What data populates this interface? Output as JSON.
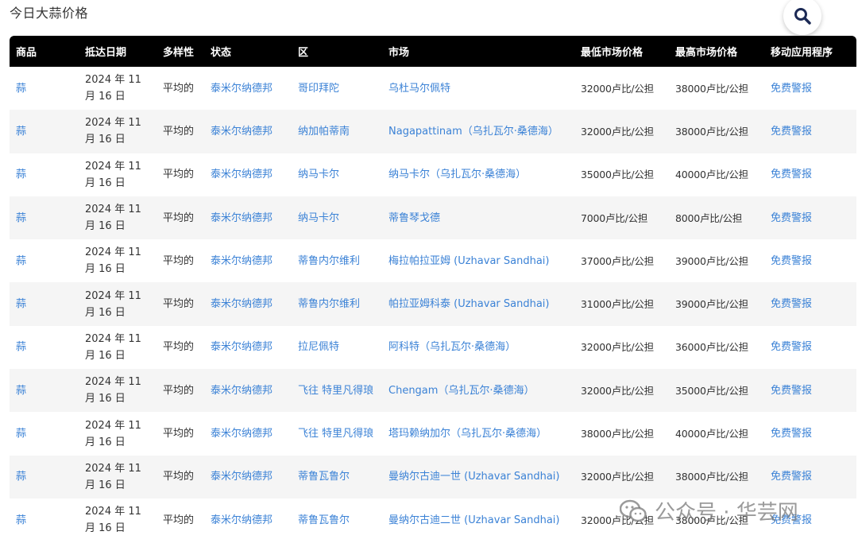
{
  "page_title": "今日大蒜价格",
  "search": {
    "icon": "search-icon"
  },
  "table": {
    "headers": [
      "商品",
      "抵达日期",
      "多样性",
      "状态",
      "区",
      "市场",
      "最低市场价格",
      "最高市场价格",
      "移动应用程序"
    ],
    "rows": [
      [
        "蒜",
        "2024 年 11 月 16 日",
        "平均的",
        "泰米尔纳德邦",
        "哥印拜陀",
        "乌杜马尔佩特",
        "32000卢比/公担",
        "38000卢比/公担",
        "免费警报"
      ],
      [
        "蒜",
        "2024 年 11 月 16 日",
        "平均的",
        "泰米尔纳德邦",
        "纳加帕蒂南",
        "Nagapattinam（乌扎瓦尔·桑德海）",
        "32000卢比/公担",
        "38000卢比/公担",
        "免费警报"
      ],
      [
        "蒜",
        "2024 年 11 月 16 日",
        "平均的",
        "泰米尔纳德邦",
        "纳马卡尔",
        "纳马卡尔（乌扎瓦尔·桑德海）",
        "35000卢比/公担",
        "40000卢比/公担",
        "免费警报"
      ],
      [
        "蒜",
        "2024 年 11 月 16 日",
        "平均的",
        "泰米尔纳德邦",
        "纳马卡尔",
        "蒂鲁琴戈德",
        "7000卢比/公担",
        "8000卢比/公担",
        "免费警报"
      ],
      [
        "蒜",
        "2024 年 11 月 16 日",
        "平均的",
        "泰米尔纳德邦",
        "蒂鲁内尔维利",
        "梅拉帕拉亚姆 (Uzhavar Sandhai)",
        "37000卢比/公担",
        "39000卢比/公担",
        "免费警报"
      ],
      [
        "蒜",
        "2024 年 11 月 16 日",
        "平均的",
        "泰米尔纳德邦",
        "蒂鲁内尔维利",
        "帕拉亚姆科泰 (Uzhavar Sandhai)",
        "31000卢比/公担",
        "39000卢比/公担",
        "免费警报"
      ],
      [
        "蒜",
        "2024 年 11 月 16 日",
        "平均的",
        "泰米尔纳德邦",
        "拉尼佩特",
        "阿科特（乌扎瓦尔·桑德海）",
        "32000卢比/公担",
        "36000卢比/公担",
        "免费警报"
      ],
      [
        "蒜",
        "2024 年 11 月 16 日",
        "平均的",
        "泰米尔纳德邦",
        "飞往 特里凡得琅",
        "Chengam（乌扎瓦尔·桑德海）",
        "32000卢比/公担",
        "35000卢比/公担",
        "免费警报"
      ],
      [
        "蒜",
        "2024 年 11 月 16 日",
        "平均的",
        "泰米尔纳德邦",
        "飞往 特里凡得琅",
        "塔玛赖纳加尔（乌扎瓦尔·桑德海）",
        "38000卢比/公担",
        "40000卢比/公担",
        "免费警报"
      ],
      [
        "蒜",
        "2024 年 11 月 16 日",
        "平均的",
        "泰米尔纳德邦",
        "蒂鲁瓦鲁尔",
        "曼纳尔古迪一世 (Uzhavar Sandhai)",
        "32000卢比/公担",
        "38000卢比/公担",
        "免费警报"
      ],
      [
        "蒜",
        "2024 年 11 月 16 日",
        "平均的",
        "泰米尔纳德邦",
        "蒂鲁瓦鲁尔",
        "曼纳尔古迪二世 (Uzhavar Sandhai)",
        "32000卢比/公担",
        "38000卢比/公担",
        "免费警报"
      ]
    ]
  },
  "watermark": {
    "text": "公众号 · 华芸网",
    "icon": "wechat-icon"
  },
  "colors": {
    "link": "#3b82d6",
    "header_bg": "#000000",
    "row_alt": "#f5f5f5"
  }
}
